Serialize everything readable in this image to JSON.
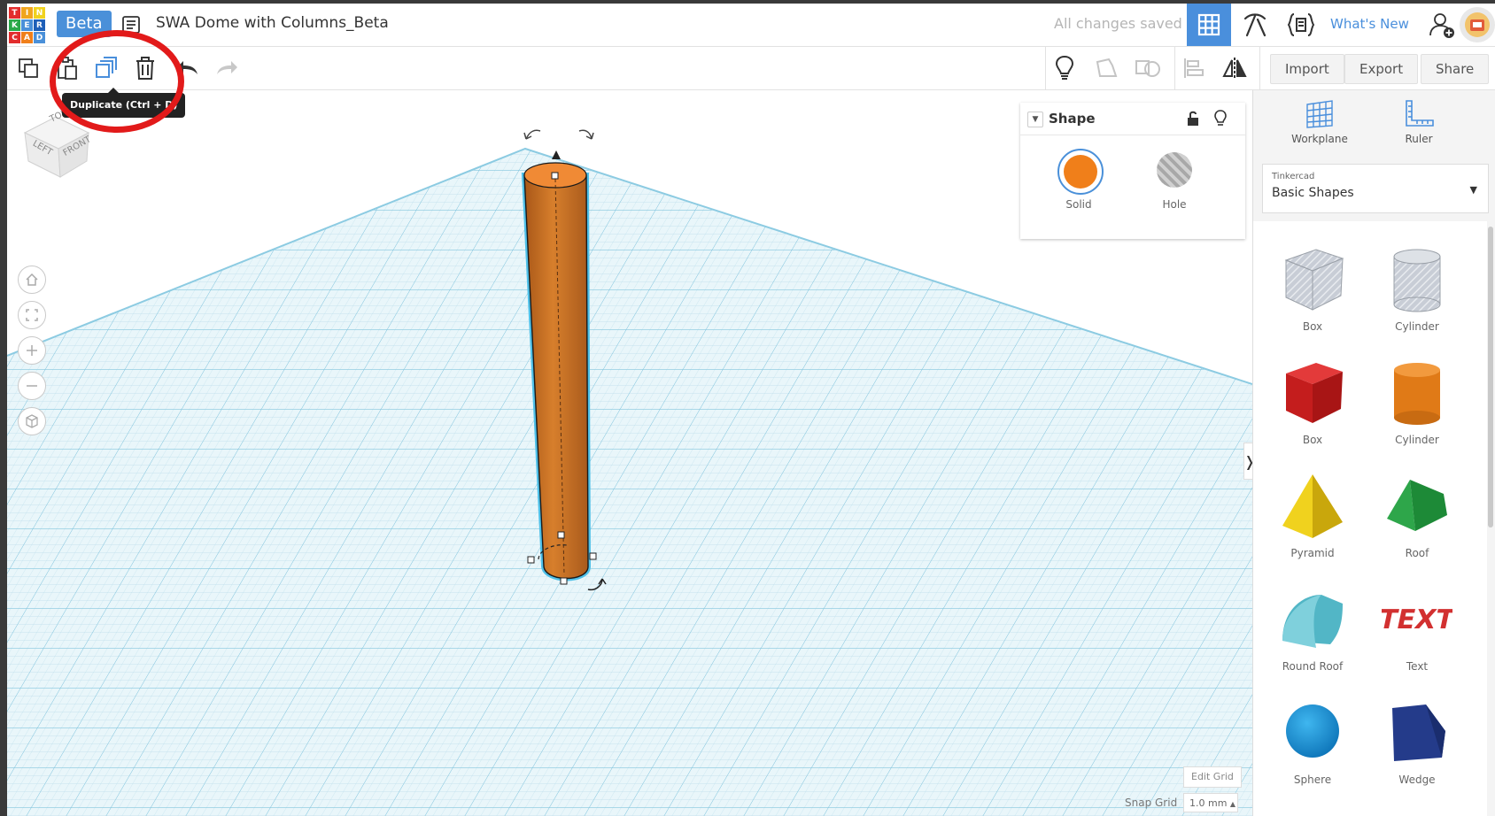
{
  "app": {
    "logo_letters": [
      "T",
      "I",
      "N",
      "K",
      "E",
      "R",
      "C",
      "A",
      "D"
    ],
    "logo_colors": [
      "#e22d2d",
      "#f0a51e",
      "#f0d21e",
      "#2aa948",
      "#4a90d9",
      "#1e5fb8",
      "#e22d2d",
      "#f07f1a",
      "#4a90d9"
    ],
    "beta_label": "Beta",
    "document_title": "SWA Dome with Columns_Beta",
    "save_status": "All changes saved",
    "whats_new_label": "What's New",
    "accent_color": "#4a8fdc"
  },
  "toolbar": {
    "tooltip": "Duplicate (Ctrl + D)",
    "import_label": "Import",
    "export_label": "Export",
    "share_label": "Share"
  },
  "viewcube": {
    "top_label": "TOP",
    "left_label": "LEFT",
    "front_label": "FRONT"
  },
  "shape_panel": {
    "title": "Shape",
    "solid_label": "Solid",
    "hole_label": "Hole",
    "solid_color": "#f07f1a"
  },
  "grid": {
    "edit_grid_label": "Edit Grid",
    "snap_grid_label": "Snap Grid",
    "snap_value": "1.0 mm"
  },
  "right_panel": {
    "workplane_label": "Workplane",
    "ruler_label": "Ruler",
    "library_source": "Tinkercad",
    "library_name": "Basic Shapes",
    "shapes": [
      {
        "label": "Box"
      },
      {
        "label": "Cylinder"
      },
      {
        "label": "Box"
      },
      {
        "label": "Cylinder"
      },
      {
        "label": "Pyramid"
      },
      {
        "label": "Roof"
      },
      {
        "label": "Round Roof"
      },
      {
        "label": "Text"
      },
      {
        "label": "Sphere"
      },
      {
        "label": "Wedge"
      }
    ]
  }
}
